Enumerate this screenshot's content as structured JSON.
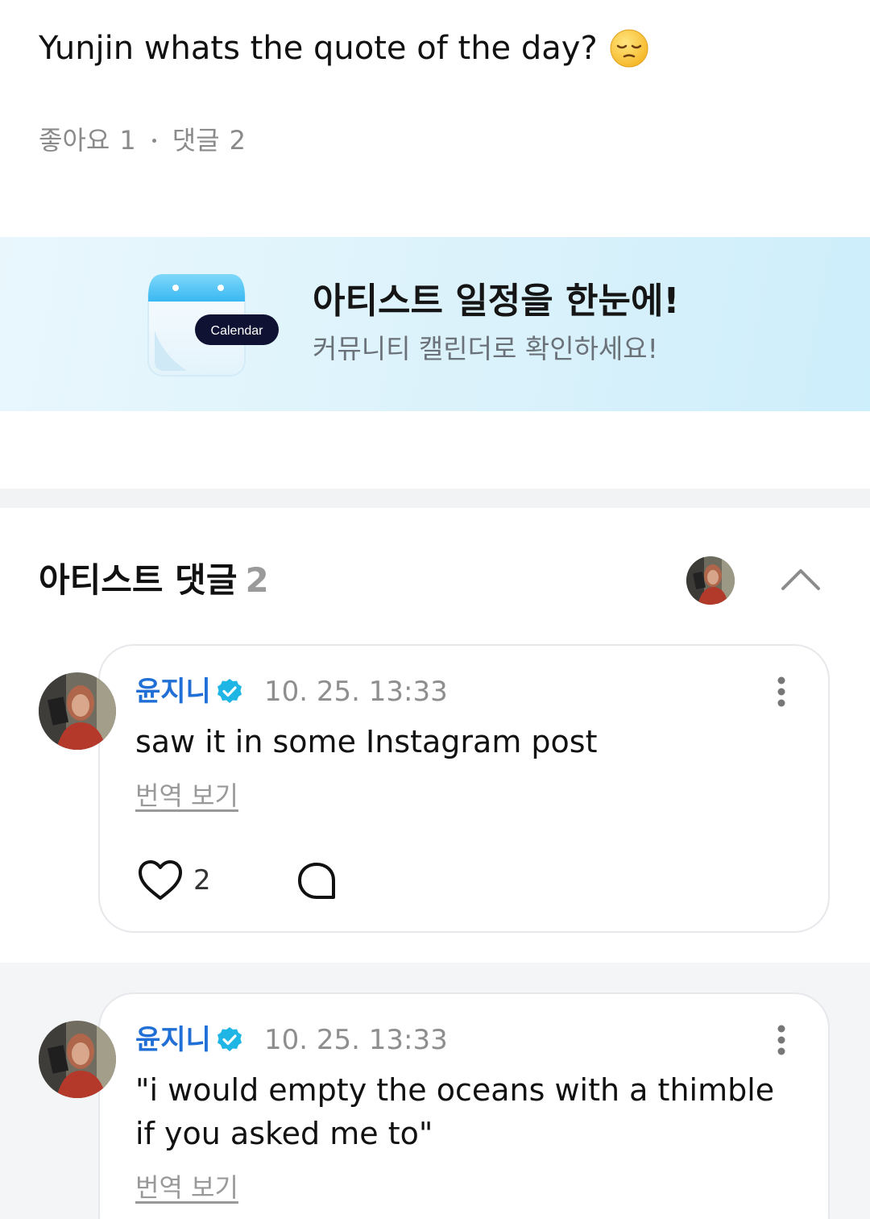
{
  "post": {
    "text": "Yunjin whats the quote of the day?",
    "emoji": "relieved-face-emoji",
    "likes_label": "좋아요",
    "likes_count": "1",
    "comments_label": "댓글",
    "comments_count": "2"
  },
  "banner": {
    "title": "아티스트 일정을 한눈에!",
    "subtitle": "커뮤니티 캘린더로 확인하세요!",
    "calendar_label": "Calendar"
  },
  "artist_comments": {
    "title": "아티스트 댓글",
    "count": "2",
    "collapse_icon": "chevron-up-icon"
  },
  "comments": [
    {
      "author": "윤지니",
      "verified": true,
      "time": "10. 25. 13:33",
      "text": "saw it in some Instagram post",
      "translate_label": "번역 보기",
      "likes": "2"
    },
    {
      "author": "윤지니",
      "verified": true,
      "time": "10. 25. 13:33",
      "text": "\"i would empty the oceans with a thimble if you asked me to\"",
      "translate_label": "번역 보기"
    }
  ],
  "colors": {
    "accent_blue": "#1f6fd6",
    "verified_badge": "#1fb6e5",
    "banner_bg": "#dff3fb"
  }
}
